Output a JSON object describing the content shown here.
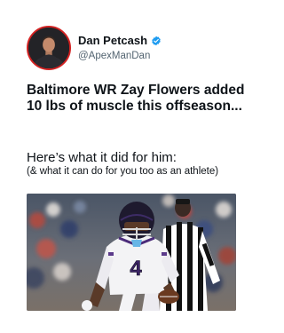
{
  "post": {
    "author": {
      "display_name": "Dan Petcash",
      "handle": "@ApexManDan",
      "verified": true,
      "avatar_icon": "profile-photo",
      "verified_icon": "verified-badge-icon",
      "verified_color": "#1d9bf0",
      "avatar_ring_color": "#d32222"
    },
    "headline": "Baltimore WR Zay Flowers added 10 lbs of muscle this offseason...",
    "subheading": "Here’s what it did for him:",
    "subnote": "(& what it can do for you too as an athlete)",
    "photo": {
      "jersey_number": "4",
      "colors": {
        "jersey": "#f3f3f5",
        "helmet": "#1e1a2e",
        "referee_stripes": "#111111"
      }
    }
  }
}
